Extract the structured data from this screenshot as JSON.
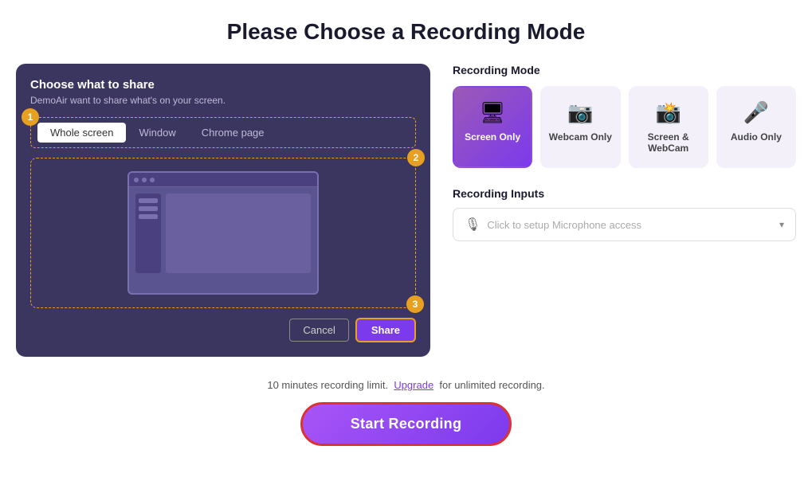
{
  "page": {
    "title": "Please Choose a Recording Mode"
  },
  "share_panel": {
    "title": "Choose what to share",
    "subtitle": "DemoAir want to share what's on your screen.",
    "tabs": [
      "Whole screen",
      "Window",
      "Chrome page"
    ],
    "active_tab": "Whole screen",
    "cancel_label": "Cancel",
    "share_label": "Share",
    "steps": [
      "1",
      "2",
      "3"
    ]
  },
  "recording_mode": {
    "section_label": "Recording Mode",
    "modes": [
      {
        "id": "screen-only",
        "label": "Screen Only",
        "icon": "🖥",
        "active": true
      },
      {
        "id": "webcam-only",
        "label": "Webcam Only",
        "icon": "📷",
        "active": false
      },
      {
        "id": "screen-webcam",
        "label": "Screen & WebCam",
        "icon": "📸",
        "active": false
      },
      {
        "id": "audio-only",
        "label": "Audio Only",
        "icon": "🎤",
        "active": false
      }
    ]
  },
  "recording_inputs": {
    "section_label": "Recording Inputs",
    "microphone_placeholder": "Click to setup Microphone access"
  },
  "bottom": {
    "limit_text_before": "10 minutes recording limit.",
    "upgrade_label": "Upgrade",
    "limit_text_after": "for unlimited recording.",
    "start_label": "Start Recording"
  }
}
